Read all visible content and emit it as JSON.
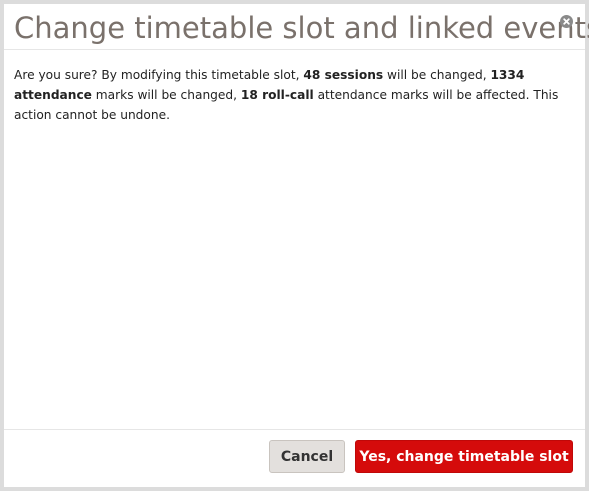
{
  "dialog": {
    "title": "Change timetable slot and linked events?",
    "close_icon": "close-circle-icon",
    "message": {
      "part1": "Are you sure? By modifying this timetable slot, ",
      "sessions": "48 sessions",
      "part2": " will be changed, ",
      "attendance": "1334 attendance",
      "part3": " marks will be changed, ",
      "rollcall": "18 roll-call",
      "part4": " attendance marks will be affected. This action cannot be undone."
    },
    "buttons": {
      "cancel_label": "Cancel",
      "confirm_label": "Yes, change timetable slot"
    }
  },
  "colors": {
    "title": "#7a716b",
    "confirm_button": "#d50b0b",
    "cancel_button": "#e3e0dd",
    "backdrop": "#dcdcdc"
  }
}
